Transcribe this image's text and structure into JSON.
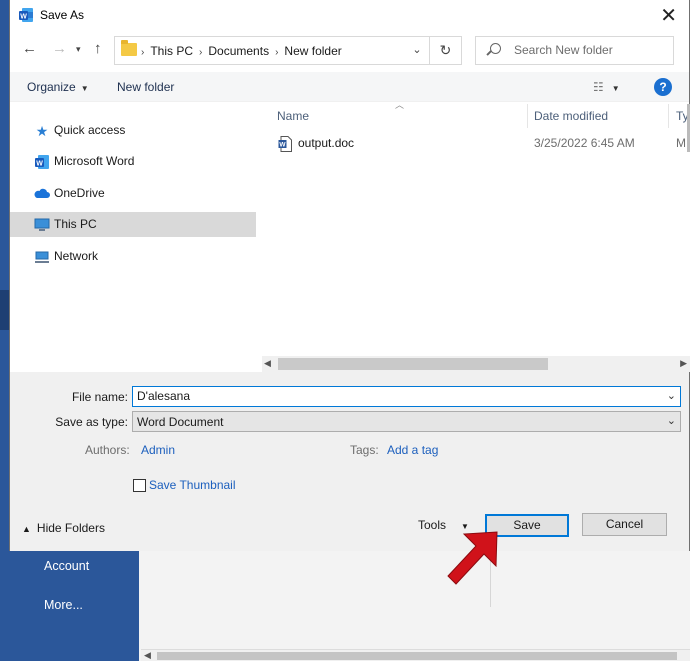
{
  "background": {
    "menu": [
      "Account",
      "More..."
    ]
  },
  "dialog": {
    "title": "Save As",
    "nav": {
      "breadcrumbs": [
        "This PC",
        "Documents",
        "New folder"
      ],
      "search_placeholder": "Search New folder"
    },
    "toolbar": {
      "organize": "Organize",
      "new_folder": "New folder"
    },
    "sidebar": {
      "items": [
        {
          "label": "Quick access",
          "icon": "star-icon"
        },
        {
          "label": "Microsoft Word",
          "icon": "word-icon"
        },
        {
          "label": "OneDrive",
          "icon": "cloud-icon"
        },
        {
          "label": "This PC",
          "icon": "monitor-icon",
          "selected": true
        },
        {
          "label": "Network",
          "icon": "network-icon"
        }
      ]
    },
    "files": {
      "columns": [
        "Name",
        "Date modified",
        "Ty"
      ],
      "rows": [
        {
          "name": "output.doc",
          "date": "3/25/2022 6:45 AM",
          "type": "M"
        }
      ]
    },
    "form": {
      "file_name_label": "File name:",
      "file_name_value": "D'alesana",
      "save_type_label": "Save as type:",
      "save_type_value": "Word Document",
      "authors_label": "Authors:",
      "authors_value": "Admin",
      "tags_label": "Tags:",
      "tags_value": "Add a tag",
      "thumbnail_label": "Save Thumbnail"
    },
    "footer": {
      "hide_folders": "Hide Folders",
      "tools": "Tools",
      "save": "Save",
      "cancel": "Cancel"
    }
  },
  "colors": {
    "word_blue": "#2b579a",
    "accent": "#0078d7",
    "link": "#1c5fbd",
    "annotation_arrow": "#d0121a"
  }
}
